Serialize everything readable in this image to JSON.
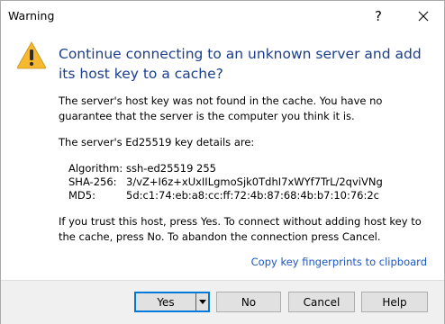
{
  "window": {
    "title": "Warning",
    "help_glyph": "?",
    "icon": "warning-icon",
    "close_icon": "close-icon",
    "accent_color": "#0078d7",
    "instruction_color": "#1a3e8f",
    "warning_color": "#f5b82e"
  },
  "main": {
    "instruction": "Continue connecting to an unknown server and add its host key to a cache?",
    "paragraph_1": "The server's host key was not found in the cache. You have no guarantee that the server is the computer you think it is.",
    "paragraph_2": "The server's Ed25519 key details are:",
    "details": {
      "algorithm_label": "Algorithm:",
      "algorithm_value": "ssh-ed25519 255",
      "sha256_label": "SHA-256:",
      "sha256_value": "3/vZ+I6z+xUxIILgmoSjk0TdhI7xWYf7TrL/2qviVNg",
      "md5_label": "MD5:",
      "md5_value": "5d:c1:74:eb:a8:cc:ff:72:4b:87:68:4b:b7:10:76:2c"
    },
    "paragraph_3": "If you trust this host, press Yes. To connect without adding host key to the cache, press No. To abandon the connection press Cancel.",
    "copy_link": "Copy key fingerprints to clipboard"
  },
  "buttons": {
    "yes": "Yes",
    "no": "No",
    "cancel": "Cancel",
    "help": "Help",
    "dropdown_icon": "dropdown-arrow-icon"
  }
}
